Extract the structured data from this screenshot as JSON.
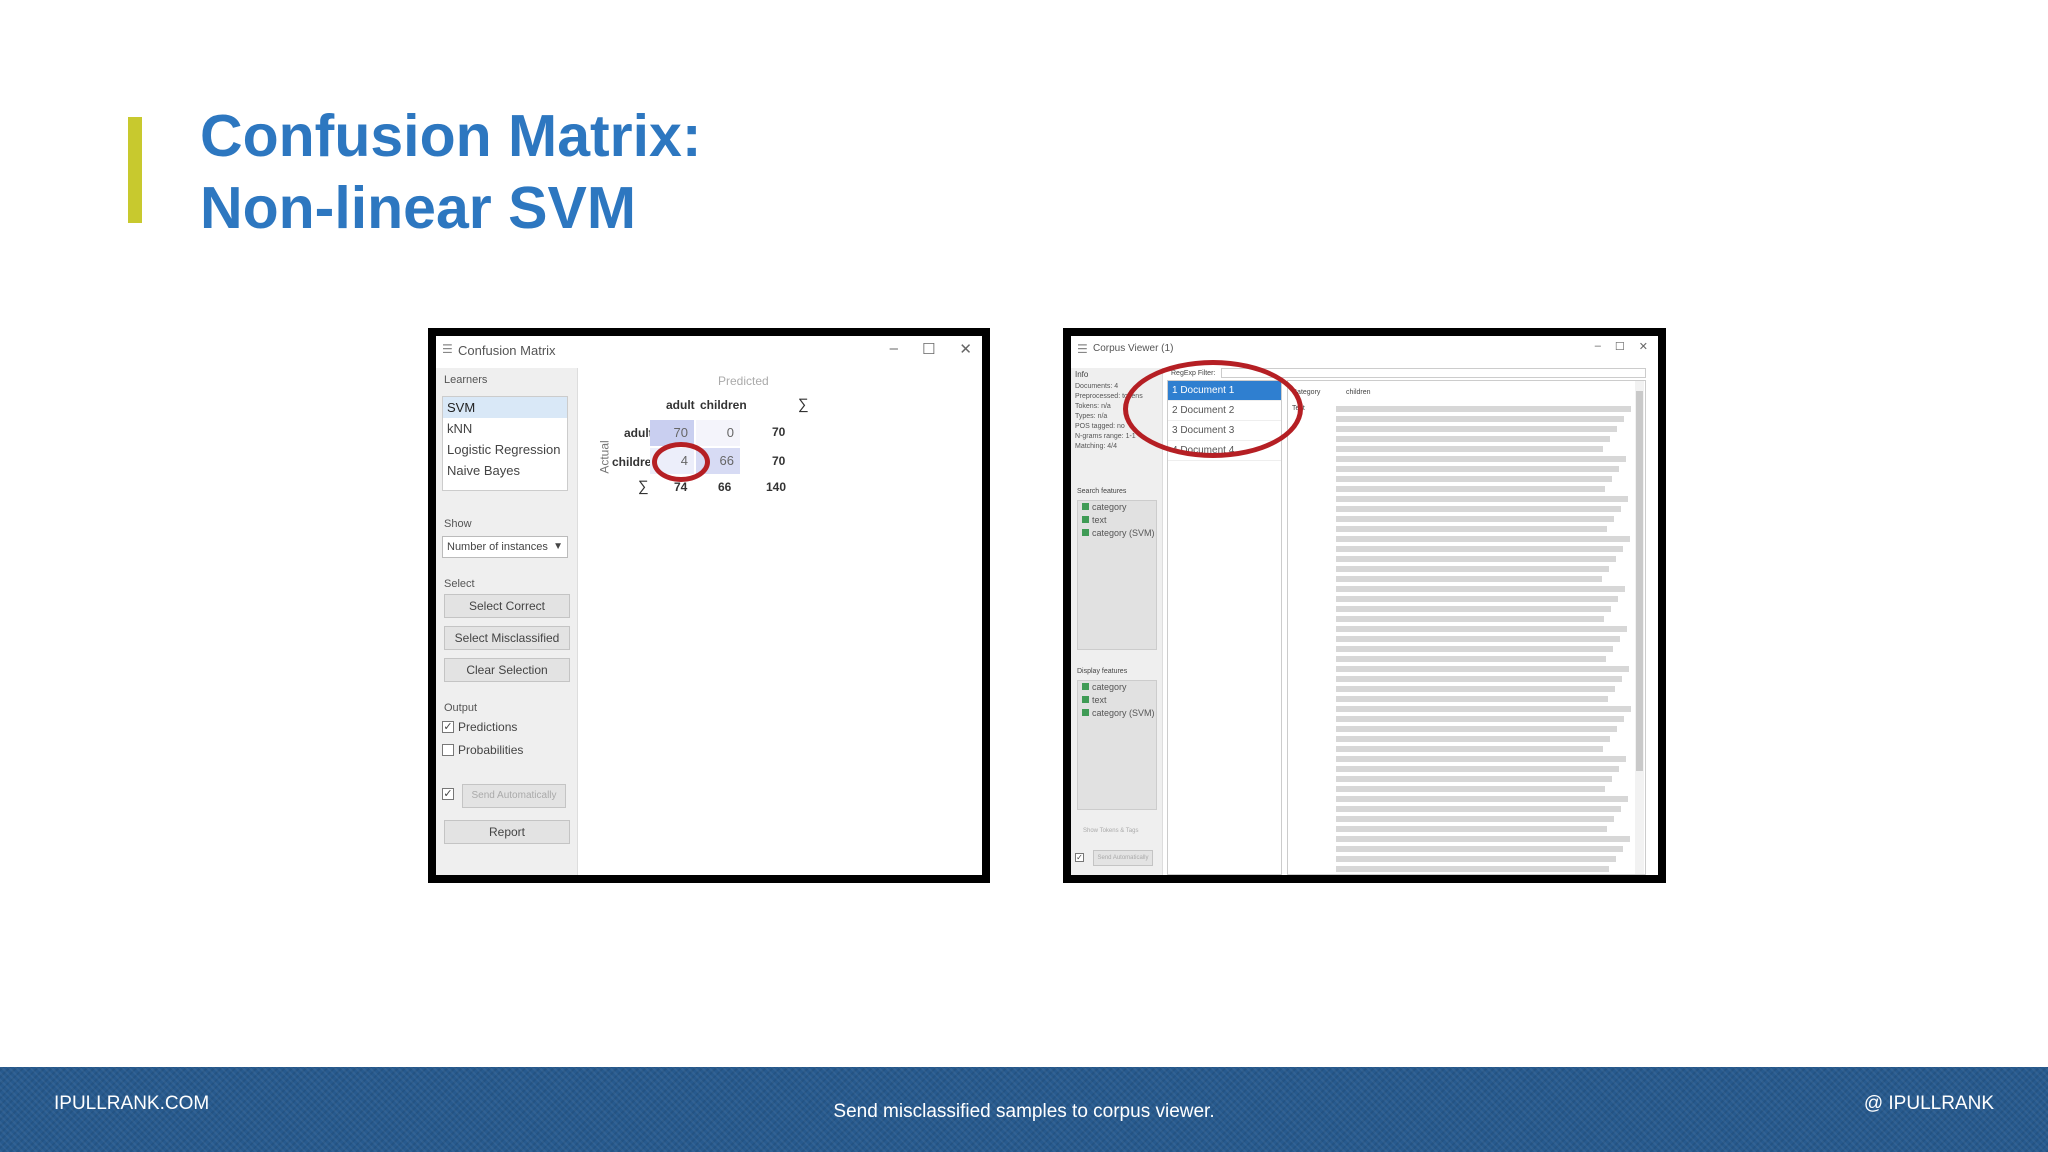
{
  "slide": {
    "title_line1": "Confusion Matrix:",
    "title_line2": "Non-linear SVM",
    "accent_color": "#c8c92e",
    "title_color": "#2d77c0"
  },
  "confusion_window": {
    "title": "Confusion Matrix",
    "controls": [
      "–",
      "☐",
      "✕"
    ],
    "learners_label": "Learners",
    "learners": [
      "SVM",
      "kNN",
      "Logistic Regression",
      "Naive Bayes"
    ],
    "selected_learner": "SVM",
    "show_label": "Show",
    "show_value": "Number of instances",
    "select_label": "Select",
    "select_correct": "Select Correct",
    "select_misclassified": "Select Misclassified",
    "clear_selection": "Clear Selection",
    "output_label": "Output",
    "predictions": "Predictions",
    "probabilities": "Probabilities",
    "send_auto": "Send Automatically",
    "report": "Report",
    "matrix": {
      "predicted_label": "Predicted",
      "actual_label": "Actual",
      "col_headers": [
        "adult",
        "children"
      ],
      "sum_symbol": "∑",
      "row_headers": [
        "adult",
        "children"
      ],
      "values": [
        [
          70,
          0
        ],
        [
          4,
          66
        ]
      ],
      "row_totals": [
        70,
        70
      ],
      "col_totals": [
        74,
        66
      ],
      "grand_total": 140
    }
  },
  "corpus_window": {
    "title": "Corpus Viewer (1)",
    "controls": [
      "–",
      "☐",
      "✕"
    ],
    "info_label": "Info",
    "info_lines": [
      "Documents: 4",
      "Preprocessed: tokens",
      "Tokens: n/a",
      "Types: n/a",
      "POS tagged: no",
      "N-grams range: 1-1",
      "Matching: 4/4"
    ],
    "search_features_label": "Search features",
    "search_features": [
      "category",
      "text",
      "category (SVM)"
    ],
    "display_features_label": "Display features",
    "display_features": [
      "category",
      "text",
      "category (SVM)"
    ],
    "show_tokens": "Show Tokens & Tags",
    "send_auto": "Send Automatically",
    "filter_label": "RegExp Filter:",
    "documents": [
      "1  Document 1",
      "2  Document 2",
      "3  Document 3",
      "4  Document 4"
    ],
    "selected_document": "1  Document 1",
    "field_category": "Category",
    "field_text": "Text",
    "category_value": "children"
  },
  "footer": {
    "left": "IPULLRANK.COM",
    "center": "Send misclassified samples to corpus viewer.",
    "right": "@ IPULLRANK"
  }
}
